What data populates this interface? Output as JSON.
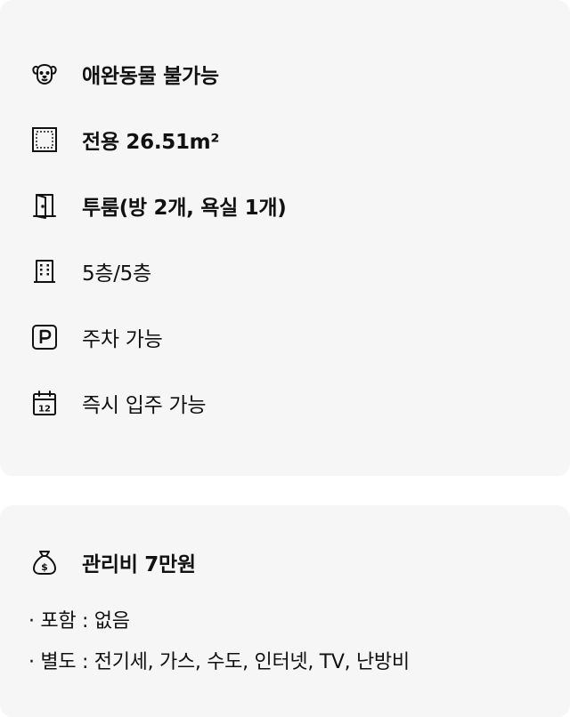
{
  "features": [
    {
      "icon": "dog-face-icon",
      "label": "애완동물 불가능",
      "bold": true
    },
    {
      "icon": "area-square-icon",
      "label": "전용 26.51m²",
      "bold": true
    },
    {
      "icon": "door-icon",
      "label": "투룸(방 2개, 욕실 1개)",
      "bold": true
    },
    {
      "icon": "building-icon",
      "label": "5층/5층",
      "bold": false
    },
    {
      "icon": "parking-icon",
      "label": "주차 가능",
      "bold": false
    },
    {
      "icon": "calendar-icon",
      "label": "즉시 입주 가능",
      "bold": false,
      "calendar_day": "12"
    }
  ],
  "fee": {
    "icon": "money-bag-icon",
    "title": "관리비 7만원",
    "included": "· 포함 : 없음",
    "separate": "· 별도 : 전기세, 가스, 수도, 인터넷, TV, 난방비"
  }
}
